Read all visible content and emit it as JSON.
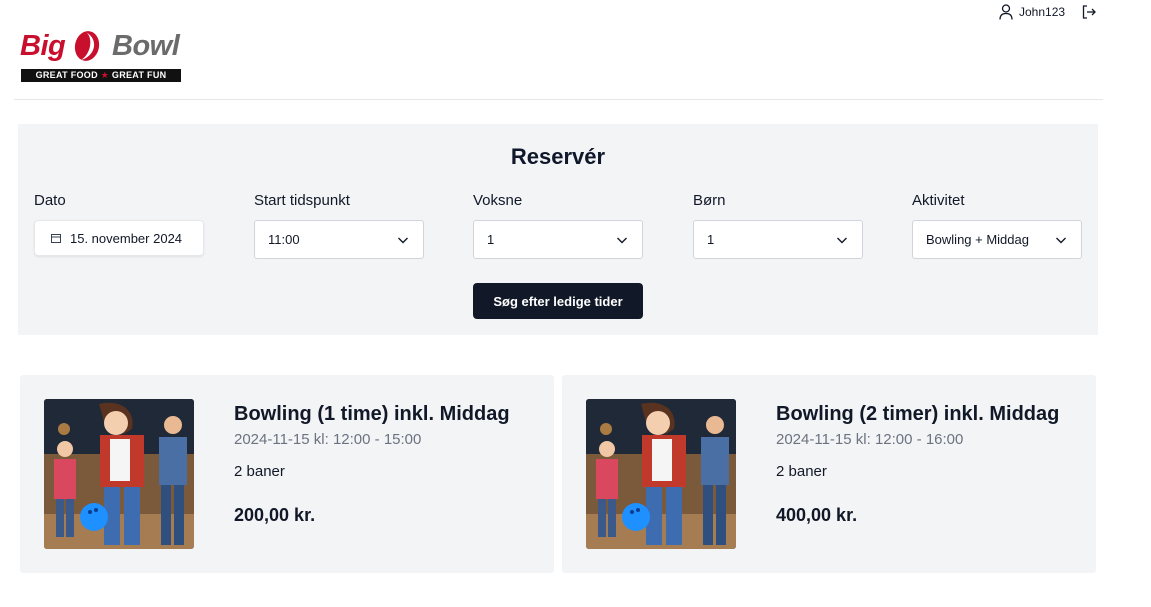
{
  "header": {
    "logo": {
      "word_left": "Big",
      "word_right": "Bowl",
      "tagline_left": "GREAT FOOD",
      "tagline_star": "★",
      "tagline_right": "GREAT FUN",
      "brand_red": "#c8102e",
      "brand_gray": "#6b6b6b"
    },
    "user": {
      "icon": "user-icon",
      "username": "John123",
      "logout_icon": "logout-icon"
    }
  },
  "reservation": {
    "title": "Reservér",
    "fields": {
      "date": {
        "label": "Dato",
        "value": "15. november 2024",
        "icon": "calendar-icon"
      },
      "start_time": {
        "label": "Start tidspunkt",
        "value": "11:00"
      },
      "adults": {
        "label": "Voksne",
        "value": "1"
      },
      "children": {
        "label": "Børn",
        "value": "1"
      },
      "activity": {
        "label": "Aktivitet",
        "value": "Bowling + Middag"
      }
    },
    "search_button": "Søg efter ledige tider"
  },
  "results": [
    {
      "title": "Bowling (1 time) inkl. Middag",
      "time": "2024-11-15 kl: 12:00 - 15:00",
      "lanes": "2 baner",
      "price": "200,00 kr."
    },
    {
      "title": "Bowling (2 timer) inkl. Middag",
      "time": "2024-11-15 kl: 12:00 - 16:00",
      "lanes": "2 baner",
      "price": "400,00 kr."
    }
  ],
  "colors": {
    "panel_bg": "#f3f4f6",
    "button_bg": "#111827",
    "muted_text": "#6b7280"
  }
}
